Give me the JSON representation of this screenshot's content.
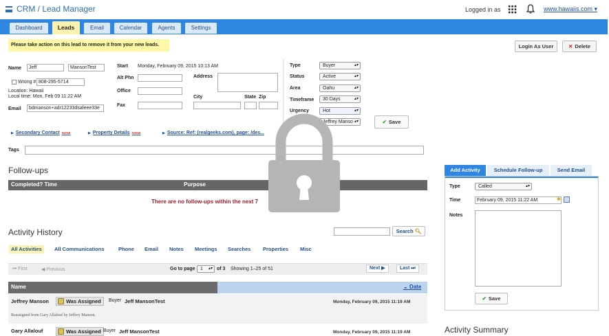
{
  "header": {
    "app_title": "CRM / Lead Manager",
    "logged_in_label": "Logged in as",
    "site_link": "www.hawaiis.com"
  },
  "tabs": [
    {
      "label": "Dashboard"
    },
    {
      "label": "Leads"
    },
    {
      "label": "Email"
    },
    {
      "label": "Calendar"
    },
    {
      "label": "Agents"
    },
    {
      "label": "Settings"
    }
  ],
  "notice": "Please take action on this lead to remove it from your new leads.",
  "actions": {
    "login_as_user": "Login As User",
    "delete": "Delete"
  },
  "lead": {
    "name_label": "Name",
    "first_name": "Jeff",
    "last_name": "MansonTest",
    "wrong_label": "Wrong #",
    "phone": "808-295-5714",
    "location": "Location: Hawaii",
    "local_time": "Local time: Mon, Feb 09 11:22 AM",
    "email_label": "Email",
    "email": "bdmanson+adr12233dsafeee33e",
    "start_label": "Start",
    "start_value": "Monday, February 09, 2015 10:13 AM",
    "alt_phn_label": "Alt Phn",
    "office_label": "Office",
    "fax_label": "Fax",
    "address_label": "Address",
    "city_label": "City",
    "state_label": "State",
    "zip_label": "Zip"
  },
  "lead_fields": {
    "type_label": "Type",
    "type_value": "Buyer",
    "status_label": "Status",
    "status_value": "Active",
    "area_label": "Area",
    "area_value": "Oahu",
    "timeframe_label": "Timeframe",
    "timeframe_value": "30 Days",
    "urgency_label": "Urgency",
    "urgency_value": "Hot",
    "agent_label": "Agent",
    "agent_value": "Jeffrey Manso",
    "save_label": "Save"
  },
  "links": {
    "secondary_contact": "Secondary Contact",
    "property_details": "Property Details",
    "none_badge": "NONE",
    "source": "Source: Ref: (realgeeks.com), page: /des..."
  },
  "tags_label": "Tags",
  "followups": {
    "title": "Follow-ups",
    "col_completed": "Completed? Time",
    "col_purpose": "Purpose",
    "empty_message": "There are no follow-ups within the next 7"
  },
  "activity": {
    "title": "Activity History",
    "search_label": "Search",
    "filters": [
      "All Activities",
      "All Communications",
      "Phone",
      "Email",
      "Notes",
      "Meetings",
      "Searches",
      "Properties",
      "Misc"
    ],
    "pager": {
      "first": "First",
      "previous": "Previous",
      "go_to_page": "Go to page",
      "page": "1",
      "of_pages": "of 3",
      "showing": "Showing 1–25 of 51",
      "next": "Next",
      "last": "Last"
    },
    "col_name": "Name",
    "col_date": "Date",
    "rows": [
      {
        "name": "Jeffrey Manson",
        "badge": "Was Assigned",
        "role": "Buyer",
        "target": "Jeff MansonTest",
        "date": "Monday, February 09, 2015 11:19 AM",
        "note": "Reassigned from Gary Allalouf by Jeffrey Manson."
      },
      {
        "name": "Gary Allalouf",
        "badge": "Was Assigned",
        "role": "Buyer",
        "target": "Jeff MansonTest",
        "date": "Monday, February 09, 2015 11:19 AM",
        "note": ""
      }
    ]
  },
  "side": {
    "tabs": [
      "Add Activity",
      "Schedule Follow-up",
      "Send Email"
    ],
    "type_label": "Type",
    "type_value": "Called",
    "time_label": "Time",
    "time_value": "February 09, 2015 11:22 AM",
    "notes_label": "Notes",
    "save_label": "Save",
    "summary_title": "Activity Summary"
  },
  "colors": {
    "accent": "#2f86e0",
    "highlight": "#fdf3b0",
    "alert": "#9b1d2e"
  },
  "icons": [
    "menu-icon",
    "apps-grid-icon",
    "bell-icon",
    "delete-x-icon",
    "check-icon",
    "search-icon",
    "calendar-icon",
    "lock-icon",
    "badge-icon"
  ]
}
